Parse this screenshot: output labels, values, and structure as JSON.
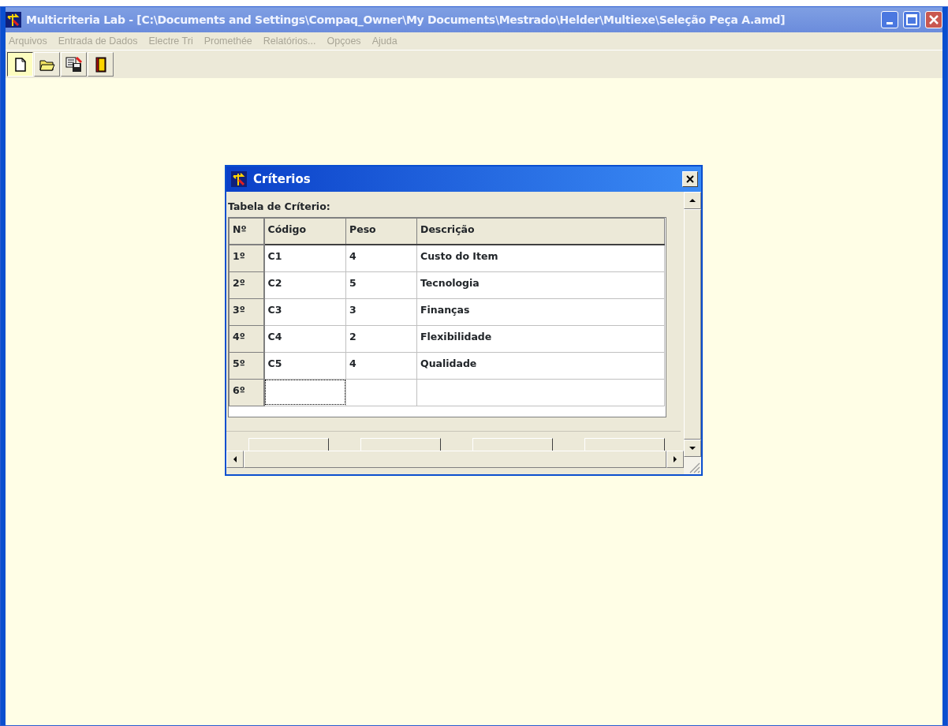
{
  "window": {
    "title": "Multicriteria Lab - [C:\\Documents and Settings\\Compaq_Owner\\My Documents\\Mestrado\\Helder\\Multiexe\\Seleção Peça A.amd]"
  },
  "menu": [
    {
      "label": "Arquivos",
      "disabled": true
    },
    {
      "label": "Entrada de Dados",
      "disabled": true
    },
    {
      "label": "Electre Tri",
      "disabled": true
    },
    {
      "label": "Promethée",
      "disabled": true
    },
    {
      "label": "Relatórios...",
      "disabled": true
    },
    {
      "label": "Opçoes",
      "disabled": true
    },
    {
      "label": "Ajuda",
      "disabled": true
    }
  ],
  "toolbar": [
    {
      "kind": "new",
      "pressed": true
    },
    {
      "kind": "open",
      "pressed": false
    },
    {
      "kind": "save",
      "pressed": false
    },
    {
      "kind": "exit",
      "pressed": false
    }
  ],
  "dialog": {
    "title": "Críterios",
    "label": "Tabela de Críterio:",
    "table": {
      "columns": [
        "Nº",
        "Código",
        "Peso",
        "Descrição"
      ],
      "rows": [
        {
          "number": "1º",
          "code": "C1",
          "weight": "4",
          "description": "Custo do Item",
          "focused": false
        },
        {
          "number": "2º",
          "code": "C2",
          "weight": "5",
          "description": "Tecnologia",
          "focused": false
        },
        {
          "number": "3º",
          "code": "C3",
          "weight": "3",
          "description": "Finanças",
          "focused": false
        },
        {
          "number": "4º",
          "code": "C4",
          "weight": "2",
          "description": "Flexibilidade",
          "focused": false
        },
        {
          "number": "5º",
          "code": "C5",
          "weight": "4",
          "description": "Qualidade",
          "focused": false
        },
        {
          "number": "6º",
          "code": "",
          "weight": "",
          "description": "",
          "focused": true
        }
      ]
    }
  }
}
